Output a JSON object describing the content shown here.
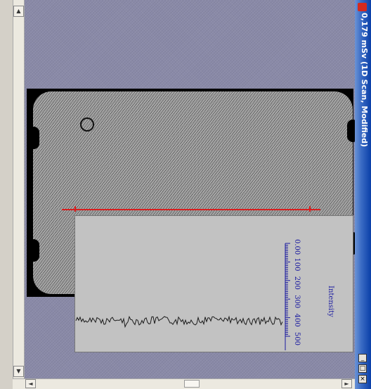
{
  "window": {
    "title": "0,179 mSv (1D Scan, Modified)",
    "buttons": {
      "minimize": "_",
      "restore": "□",
      "close": "×"
    }
  },
  "scrollbars": {
    "up_arrow": "▲",
    "down_arrow": "▼",
    "left_arrow": "◄",
    "right_arrow": "►"
  },
  "plot": {
    "axis_title": "Intensity",
    "tick_labels": [
      "0.00",
      "100",
      "200",
      "300",
      "400",
      "500"
    ],
    "line_color": "#1a1a1a",
    "axis_color": "#1a1aa0"
  },
  "colors": {
    "scan_line": "#d81e1e",
    "titlebar": "#0a3fa8"
  }
}
